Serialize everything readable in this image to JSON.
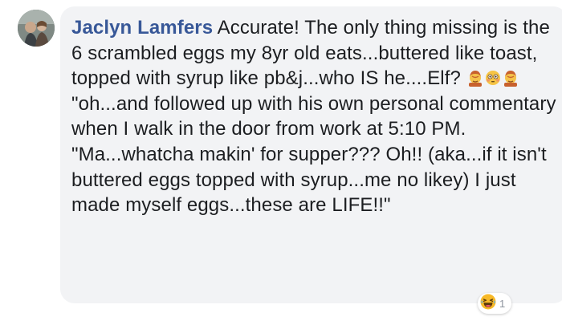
{
  "comment": {
    "author": "Jaclyn Lamfers",
    "text_part1": "Accurate! The only thing missing is the 6 scrambled eggs my 8yr old eats...buttered like toast, topped with syrup like pb&j...who IS he....Elf?",
    "emojis": [
      "woman-facepalming-icon",
      "flushed-face-icon",
      "woman-facepalming-icon"
    ],
    "text_part2": "\"oh...and followed up with his own personal commentary when I walk in the door from work at 5:10 PM. \"Ma...whatcha makin' for supper??? Oh!! (aka...if it isn't buttered eggs topped with syrup...me no likey) I just made myself eggs...these are LIFE!!\""
  },
  "reactions": {
    "icon": "laughing-face-icon",
    "count": "1"
  },
  "colors": {
    "author": "#385898",
    "text": "#1c1e21",
    "bubble": "#f2f3f5",
    "reaction_count": "#8d949e"
  }
}
